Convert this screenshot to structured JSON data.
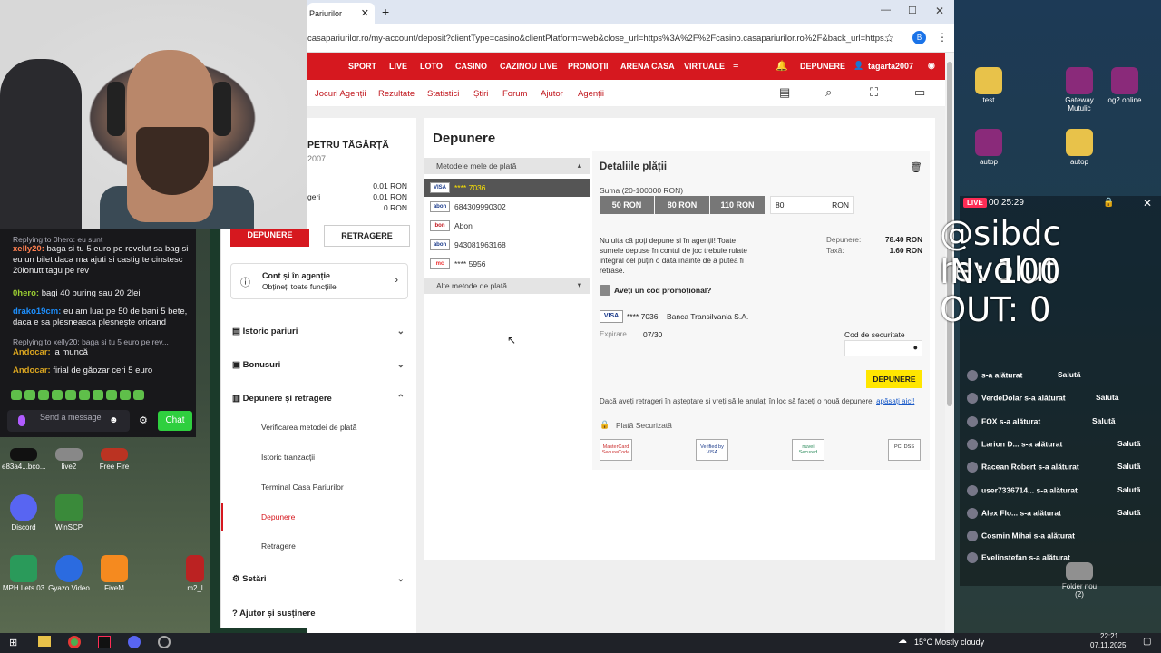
{
  "browser": {
    "tab_title": "Pariurilor",
    "url": "casapariurilor.ro/my-account/deposit?clientType=casino&clientPlatform=web&close_url=https%3A%2F%2Fcasino.casapariurilor.ro%2F&back_url=https...",
    "profile_letter": "B"
  },
  "site": {
    "nav": [
      "SPORT",
      "LIVE",
      "LOTO",
      "CASINO",
      "CAZINOU LIVE",
      "PROMOȚII",
      "ARENA CASA",
      "VIRTUALE"
    ],
    "deposit_button": "DEPUNERE",
    "username": "tagarta2007",
    "subnav": [
      "Jocuri Agenții",
      "Rezultate",
      "Statistici",
      "Știri",
      "Forum",
      "Ajutor",
      "Agenții"
    ],
    "account": {
      "name": "PETRU TĂGÂRȚĂ",
      "id": "2007",
      "balances": [
        "0.01 RON",
        "0.01 RON",
        "0 RON"
      ],
      "balance_label_2": "geri"
    },
    "deposit": {
      "title": "Depunere",
      "my_methods": "Metodele mele de plată",
      "methods": [
        {
          "logo": "VISA",
          "label": "**** 7036",
          "selected": true
        },
        {
          "logo": "abon",
          "label": "684309990302"
        },
        {
          "logo": "bon",
          "label": "Abon"
        },
        {
          "logo": "abon",
          "label": "943081963168"
        },
        {
          "logo": "mc",
          "label": "**** 5956"
        }
      ],
      "other_methods": "Alte metode de plată",
      "details_title": "Detaliile plății",
      "sum_label": "Suma (20-100000 RON)",
      "amounts": [
        "50 RON",
        "80 RON",
        "110 RON"
      ],
      "amount_value": "80",
      "currency": "RON",
      "notice": "Nu uita că poți depune și în agenții! Toate sumele depuse în contul de joc trebuie rulate integral cel puțin o dată înainte de a putea fi retrase.",
      "deposit_label": "Depunere:",
      "deposit_value": "78.40 RON",
      "fee_label": "Taxă:",
      "fee_value": "1.60 RON",
      "promo_label": "Aveți un cod promoțional?",
      "card_number": "**** 7036",
      "bank": "Banca Transilvania S.A.",
      "expiry_label": "Expirare",
      "expiry_value": "07/30",
      "cvv_label": "Cod de securitate",
      "submit": "DEPUNERE",
      "pending_text": "Dacă aveți retrageri în așteptare și vreți să le anulați în loc să faceți o nouă depunere,",
      "pending_link": "apăsați aici!",
      "secure": "Plată Securizată",
      "badges": [
        "MasterCard SecureCode",
        "Verified by VISA",
        "nuvei Secured",
        "PCI DSS"
      ]
    },
    "menu": {
      "deposit_btn": "DEPUNERE",
      "withdraw_btn": "RETRAGERE",
      "agency_title": "Cont și în agenție",
      "agency_sub": "Obțineți toate funcțiile",
      "items": [
        "Istoric pariuri",
        "Bonusuri",
        "Depunere și retragere"
      ],
      "subitems": [
        "Verificarea metodei de plată",
        "Istoric tranzacții",
        "Terminal Casa Pariurilor",
        "Depunere",
        "Retragere"
      ],
      "items2": [
        "Setări",
        "Ajutor și susținere"
      ]
    }
  },
  "chat": {
    "messages": [
      {
        "reply": "Replying to 0hero: eu sunt"
      },
      {
        "user": "xelly20:",
        "text": "baga si tu 5 euro pe revolut sa bag si eu un bilet daca ma ajuti si castig te cinstesc 20lonutt tagu pe rev"
      },
      {
        "user": "0hero:",
        "text": "bagi 40 buring sau 20 2lei"
      },
      {
        "user": "drako19cm:",
        "text": "eu am luat pe 50 de bani 5 bete, daca e sa plesneasca plesnește oricand"
      },
      {
        "reply": "Replying to xelly20: baga si tu 5 euro pe rev..."
      },
      {
        "user": "Andocar:",
        "text": "la muncă"
      },
      {
        "user": "Andocar:",
        "text": "firial de găozar ceri 5 euro"
      }
    ],
    "input_placeholder": "Send a message",
    "send": "Chat"
  },
  "desktop": {
    "left_icons": [
      "e83a4...bco...",
      "live2",
      "Free Fire",
      "Discord",
      "WinSCP",
      "MPH Lets 03",
      "Gyazo Video",
      "FiveM",
      "m2_l"
    ],
    "right_icons": [
      "test",
      "Gateway Mutulic",
      "og2.online",
      "autop",
      "autop",
      "Folder nou (2)"
    ]
  },
  "stream": {
    "live": "LIVE",
    "timer": "00:25:29",
    "line1": "@sibdc revolut",
    "line2": "IN: 100",
    "line3": "OUT: 0",
    "joined": [
      {
        "user": "",
        "text": "s-a alăturat",
        "wave": "Salută"
      },
      {
        "user": "VerdeDolar",
        "text": "s-a alăturat",
        "wave": "Salută"
      },
      {
        "user": "FOX",
        "text": "s-a alăturat",
        "wave": "Salută"
      },
      {
        "user": "Larion D...",
        "text": "s-a alăturat",
        "wave": "Salută"
      },
      {
        "user": "Racean Robert",
        "text": "s-a alăturat",
        "wave": "Salută"
      },
      {
        "user": "user7336714...",
        "text": "s-a alăturat",
        "wave": "Salută"
      },
      {
        "user": "Alex Flo...",
        "text": "s-a alăturat",
        "wave": "Salută"
      },
      {
        "user": "Cosmin Mihai",
        "text": "s-a alăturat",
        "wave": ""
      },
      {
        "user": "Evelinstefan",
        "text": "s-a alăturat",
        "wave": ""
      }
    ]
  },
  "taskbar": {
    "weather": "15°C  Mostly cloudy",
    "time": "22:21",
    "date": "07.11.2025"
  }
}
